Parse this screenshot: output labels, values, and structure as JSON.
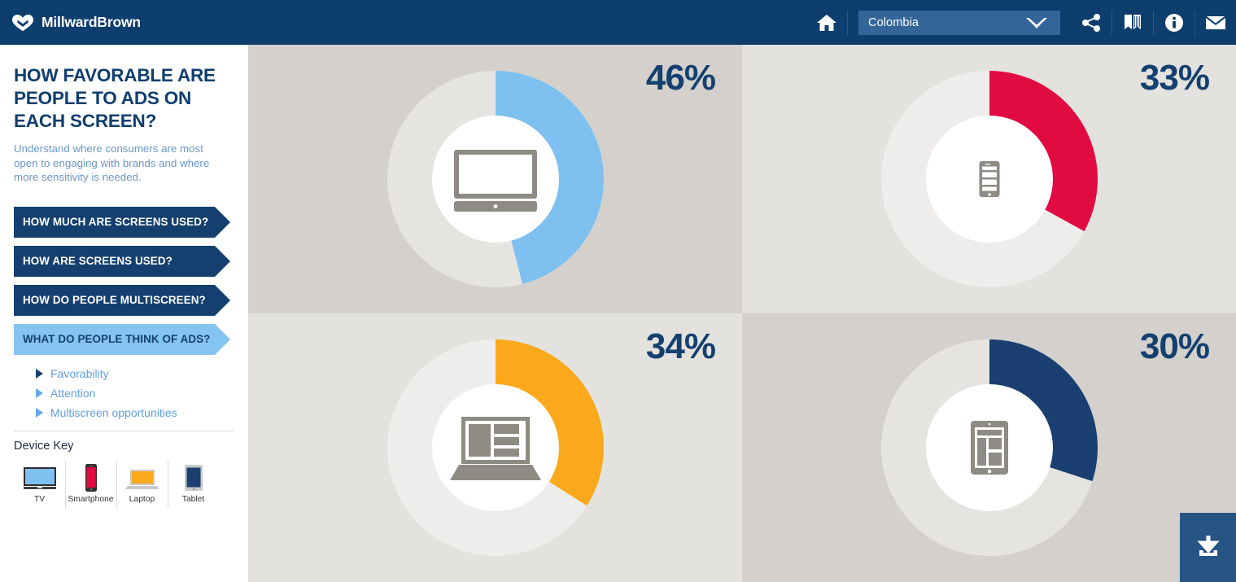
{
  "header": {
    "logo_text": "MillwardBrown",
    "logo_icon": "millward-brown-heart-logo",
    "home_icon": "home-icon",
    "country": {
      "value": "Colombia",
      "caret_icon": "chevron-down-icon"
    },
    "share_icon": "share-icon",
    "book_icon": "book-icon",
    "info_icon": "info-icon",
    "mail_icon": "mail-icon"
  },
  "sidebar": {
    "title": "HOW FAVORABLE ARE PEOPLE TO ADS ON EACH SCREEN?",
    "description": "Understand where consumers are most open to engaging with brands and where more sensitivity is needed.",
    "nav": [
      {
        "label": "HOW MUCH ARE SCREENS USED?",
        "active": false
      },
      {
        "label": "HOW ARE SCREENS USED?",
        "active": false
      },
      {
        "label": "HOW DO PEOPLE MULTISCREEN?",
        "active": false
      },
      {
        "label": "WHAT DO PEOPLE THINK OF ADS?",
        "active": true
      }
    ],
    "subnav": [
      {
        "label": "Favorability",
        "active": true
      },
      {
        "label": "Attention",
        "active": false
      },
      {
        "label": "Multiscreen opportunities",
        "active": false
      }
    ],
    "device_key": {
      "title": "Device Key",
      "items": [
        {
          "label": "TV",
          "icon": "tv-icon",
          "color": "#7ec0ef"
        },
        {
          "label": "Smartphone",
          "icon": "smartphone-icon",
          "color": "#e10b41"
        },
        {
          "label": "Laptop",
          "icon": "laptop-icon",
          "color": "#f9a91b"
        },
        {
          "label": "Tablet",
          "icon": "tablet-icon",
          "color": "#1b3f70"
        }
      ]
    }
  },
  "download": {
    "icon": "download-icon",
    "label": "Download"
  },
  "chart_data": {
    "type": "pie",
    "title": "HOW FAVORABLE ARE PEOPLE TO ADS ON EACH SCREEN?",
    "subtitle": "Understand where consumers are most open to engaging with brands and where more sensitivity is needed.",
    "unit": "%",
    "legend_position": "sidebar",
    "country": "Colombia",
    "charts": [
      {
        "category": "TV",
        "icon": "tv-icon",
        "value": 46,
        "label": "46%",
        "color": "#7ec0ef",
        "track_color": "#e6e4e1",
        "panel_background": "#d4d1cd"
      },
      {
        "category": "Smartphone",
        "icon": "smartphone-icon",
        "value": 33,
        "label": "33%",
        "color": "#e10b41",
        "track_color": "#efedeb",
        "panel_background": "#e4e2df"
      },
      {
        "category": "Laptop",
        "icon": "laptop-icon",
        "value": 34,
        "label": "34%",
        "color": "#f9a91b",
        "track_color": "#efedeb",
        "panel_background": "#e4e2df"
      },
      {
        "category": "Tablet",
        "icon": "tablet-icon",
        "value": 30,
        "label": "30%",
        "color": "#1b3f70",
        "track_color": "#e6e4e1",
        "panel_background": "#d4d1cd"
      }
    ]
  },
  "colors": {
    "brand_navy": "#0e3e6e",
    "accent_blue": "#5fa0dd",
    "text_navy": "#14406f"
  }
}
